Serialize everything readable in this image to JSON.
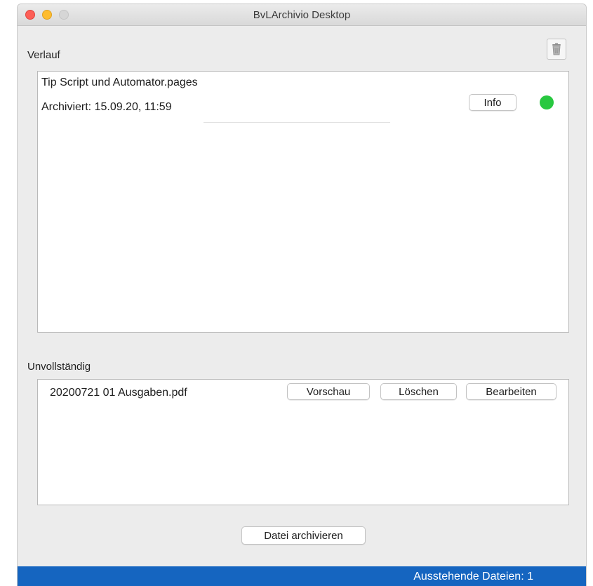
{
  "window": {
    "title": "BvLArchivio Desktop"
  },
  "toolbar": {
    "trash_icon": "trash-icon"
  },
  "history": {
    "label": "Verlauf",
    "entry": {
      "filename": "Tip Script und Automator.pages",
      "archived": "Archiviert: 15.09.20, 11:59",
      "info_label": "Info",
      "status_color": "#28c840"
    }
  },
  "incomplete": {
    "label": "Unvollständig",
    "entry": {
      "filename": "20200721 01 Ausgaben.pdf",
      "preview_label": "Vorschau",
      "delete_label": "Löschen",
      "edit_label": "Bearbeiten"
    }
  },
  "actions": {
    "archive_label": "Datei archivieren"
  },
  "status": {
    "pending": "Ausstehende Dateien:  1"
  },
  "colors": {
    "accent": "#1565c0",
    "success": "#28c840"
  }
}
